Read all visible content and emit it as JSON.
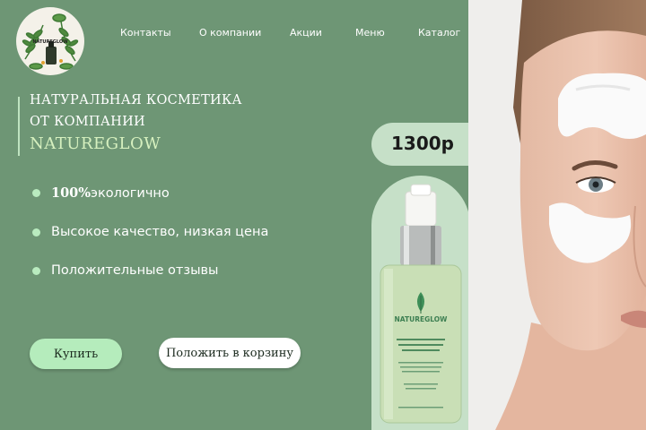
{
  "brand": {
    "logo_text": "NATUREGLOW"
  },
  "nav": {
    "items": [
      "Контакты",
      "О компании",
      "Акции",
      "Меню",
      "Каталог"
    ]
  },
  "hero": {
    "line1": "НАТУРАЛЬНАЯ КОСМЕТИКА",
    "line2": "ОТ КОМПАНИИ",
    "brand_name": "NATUREGLOW"
  },
  "features": {
    "f1_strong": "100%",
    "f1_rest": "экологично",
    "f2": "Высокое качество, низкая цена",
    "f3": "Положительные отзывы"
  },
  "buttons": {
    "buy": "Купить",
    "cart": "Положить в корзину"
  },
  "product": {
    "price": "1300р",
    "bottle_brand": "NATUREGLOW"
  },
  "colors": {
    "background": "#6e9675",
    "accent_light": "#b5ecbc",
    "panel": "#c6e0c8"
  }
}
